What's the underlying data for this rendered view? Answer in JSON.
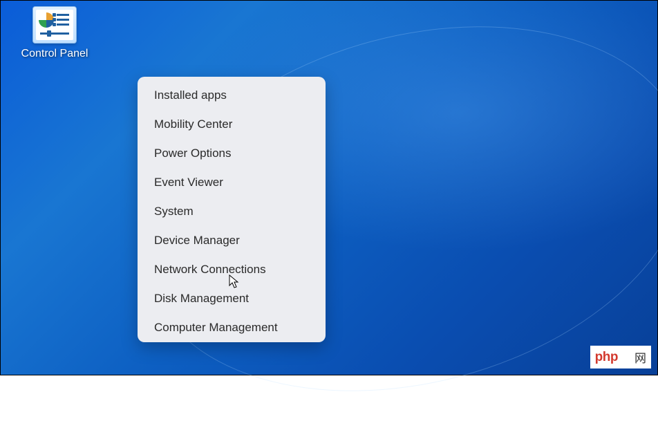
{
  "desktop": {
    "icons": [
      {
        "name": "control-panel",
        "label": "Control Panel"
      }
    ]
  },
  "context_menu": {
    "items": [
      "Installed apps",
      "Mobility Center",
      "Power Options",
      "Event Viewer",
      "System",
      "Device Manager",
      "Network Connections",
      "Disk Management",
      "Computer Management"
    ]
  },
  "watermark": {
    "prefix": "php",
    "block": "    ",
    "suffix": "网"
  }
}
